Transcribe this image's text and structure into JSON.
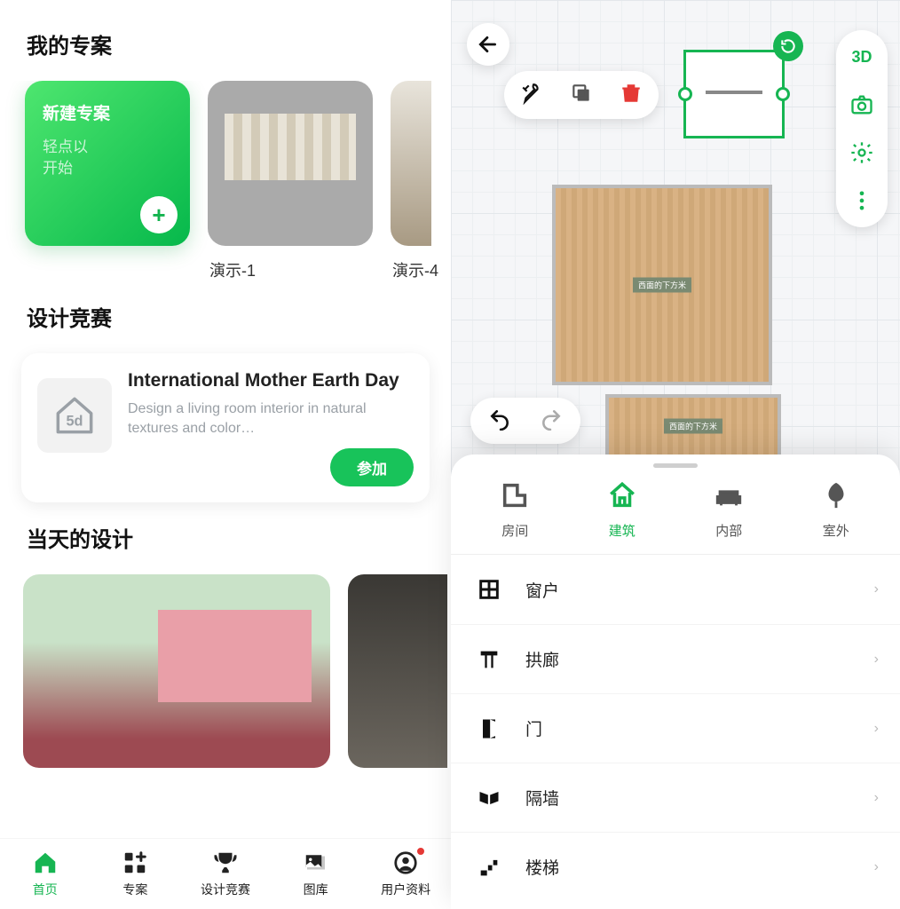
{
  "left": {
    "sections": {
      "my_projects": "我的专案",
      "contest": "设计竞赛",
      "daily": "当天的设计"
    },
    "new_project": {
      "title": "新建专案",
      "subtitle": "轻点以\n开始"
    },
    "projects": [
      {
        "name": "演示-1"
      },
      {
        "name": "演示-4"
      }
    ],
    "contest_card": {
      "icon_label": "5d",
      "title": "International Mother Earth Day",
      "desc": "Design a living room interior in natural textures and color…",
      "join": "参加"
    },
    "bottom_tabs": [
      {
        "label": "首页",
        "active": true
      },
      {
        "label": "专案",
        "active": false
      },
      {
        "label": "设计竞赛",
        "active": false
      },
      {
        "label": "图库",
        "active": false
      },
      {
        "label": "用户资料",
        "active": false,
        "badge": true
      }
    ]
  },
  "right": {
    "side_tools": {
      "view_mode": "3D"
    },
    "rooms": [
      {
        "label": "西面的下方米"
      },
      {
        "label": "西面的下方米"
      }
    ],
    "category_tabs": [
      {
        "label": "房间",
        "active": false
      },
      {
        "label": "建筑",
        "active": true
      },
      {
        "label": "内部",
        "active": false
      },
      {
        "label": "室外",
        "active": false
      }
    ],
    "items": [
      {
        "label": "窗户"
      },
      {
        "label": "拱廊"
      },
      {
        "label": "门"
      },
      {
        "label": "隔墙"
      },
      {
        "label": "楼梯"
      }
    ]
  },
  "colors": {
    "accent": "#16b552",
    "danger": "#e53935"
  }
}
